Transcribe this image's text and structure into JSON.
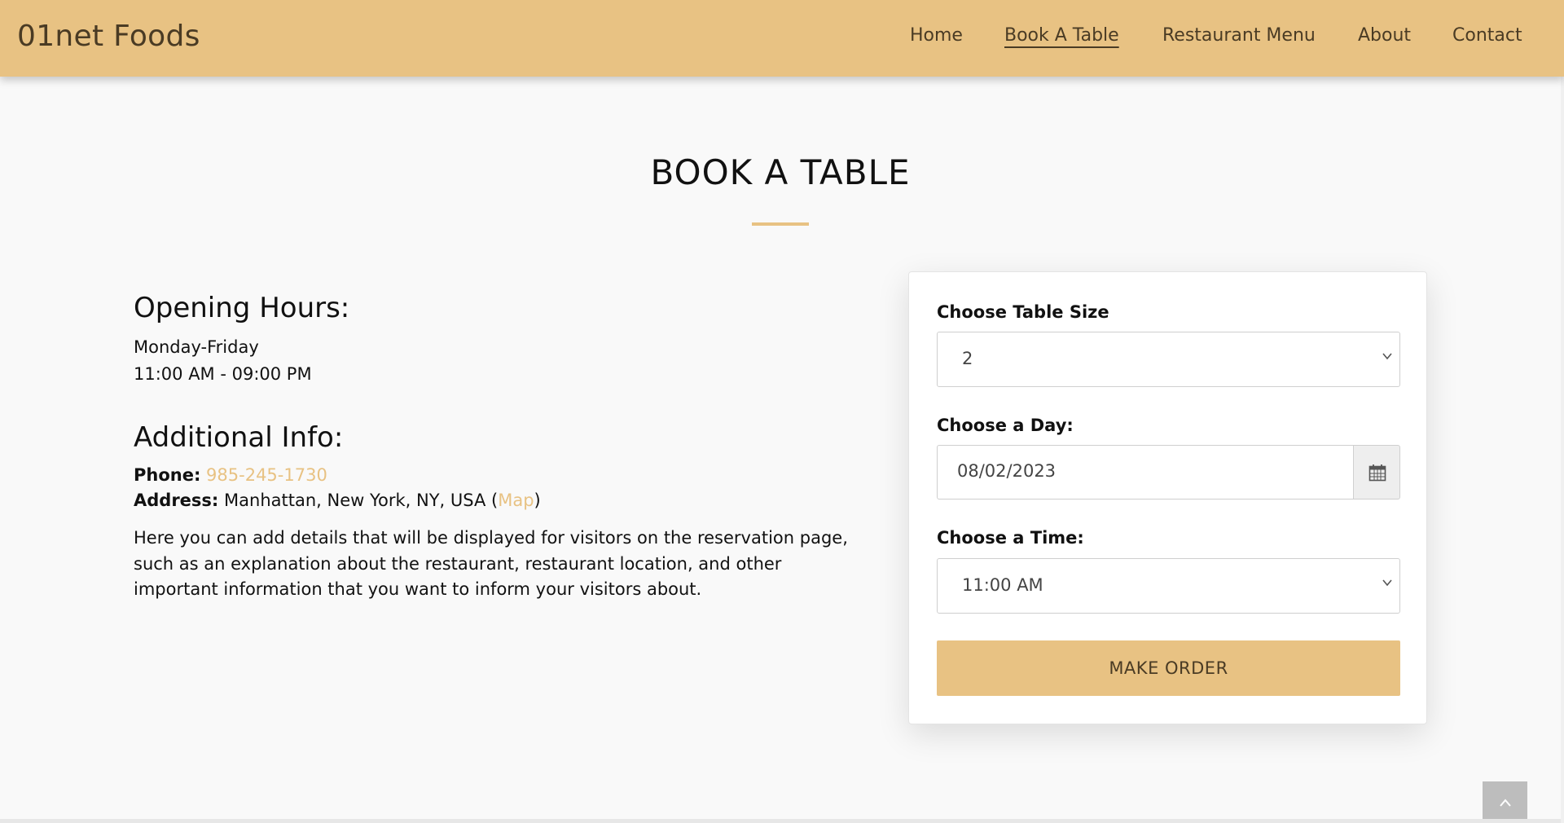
{
  "header": {
    "brand": "01net Foods",
    "nav": [
      {
        "label": "Home",
        "active": false
      },
      {
        "label": "Book A Table",
        "active": true
      },
      {
        "label": "Restaurant Menu",
        "active": false
      },
      {
        "label": "About",
        "active": false
      },
      {
        "label": "Contact",
        "active": false
      }
    ]
  },
  "page": {
    "title": "BOOK A TABLE"
  },
  "hours": {
    "heading": "Opening Hours:",
    "days": "Monday-Friday",
    "times": "11:00 AM - 09:00 PM"
  },
  "additional": {
    "heading": "Additional Info:",
    "phone_label": "Phone:",
    "phone_value": "985-245-1730",
    "address_label": "Address:",
    "address_value": "Manhattan, New York, NY, USA (",
    "map_link": "Map",
    "address_close": ")",
    "description": "Here you can add details that will be displayed for visitors on the reservation page, such as an explanation about the restaurant, restaurant location, and other important information that you want to inform your visitors about."
  },
  "form": {
    "table_size_label": "Choose Table Size",
    "table_size_value": "2",
    "day_label": "Choose a Day:",
    "day_value": "08/02/2023",
    "time_label": "Choose a Time:",
    "time_value": "11:00 AM",
    "submit_label": "MAKE ORDER"
  },
  "colors": {
    "accent": "#e8c283",
    "nav_text": "#4a3b24",
    "background": "#f9f9f9"
  },
  "icons": {
    "calendar": "calendar-icon",
    "chevron": "chevron-down-icon",
    "back_to_top": "chevron-up-icon"
  }
}
